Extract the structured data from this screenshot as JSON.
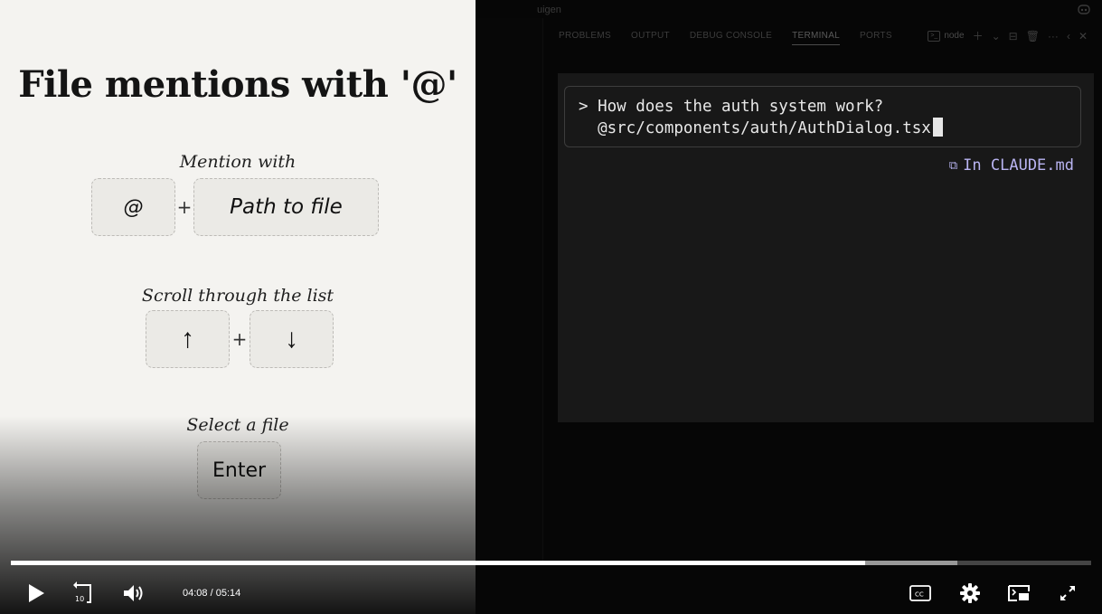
{
  "slide": {
    "title": "File mentions with '@'",
    "sections": [
      {
        "caption": "Mention with",
        "keys": [
          "@",
          "Path to file"
        ],
        "separator": "+"
      },
      {
        "caption": "Scroll through the list",
        "keys": [
          "↑",
          "↓"
        ],
        "separator": "+"
      },
      {
        "caption": "Select a file",
        "keys": [
          "Enter"
        ]
      }
    ]
  },
  "editor": {
    "window_title": "uigen",
    "panel_tabs": [
      "PROBLEMS",
      "OUTPUT",
      "DEBUG CONSOLE",
      "TERMINAL",
      "PORTS"
    ],
    "active_tab": "TERMINAL",
    "terminal_name": "node",
    "prompt": {
      "line1": "> How does the auth system work?",
      "line2": "  @src/components/auth/AuthDialog.tsx"
    },
    "memory_hint": "In CLAUDE.md"
  },
  "player": {
    "current_time": "04:08",
    "separator": "/",
    "duration": "05:14",
    "progress_fraction": 0.791,
    "buffered_fraction": 0.876,
    "rewind_seconds": "10"
  },
  "icons": {
    "play": "play-icon",
    "rewind": "rewind-10-icon",
    "volume": "volume-icon",
    "captions": "closed-captions-icon",
    "settings": "gear-icon",
    "pip": "picture-in-picture-icon",
    "fullscreen": "fullscreen-icon"
  },
  "colors": {
    "slide_bg": "#f4f3f0",
    "terminal_bg": "#181818",
    "memory_hint": "#b9b4f2",
    "progress_played": "#ffffff"
  }
}
